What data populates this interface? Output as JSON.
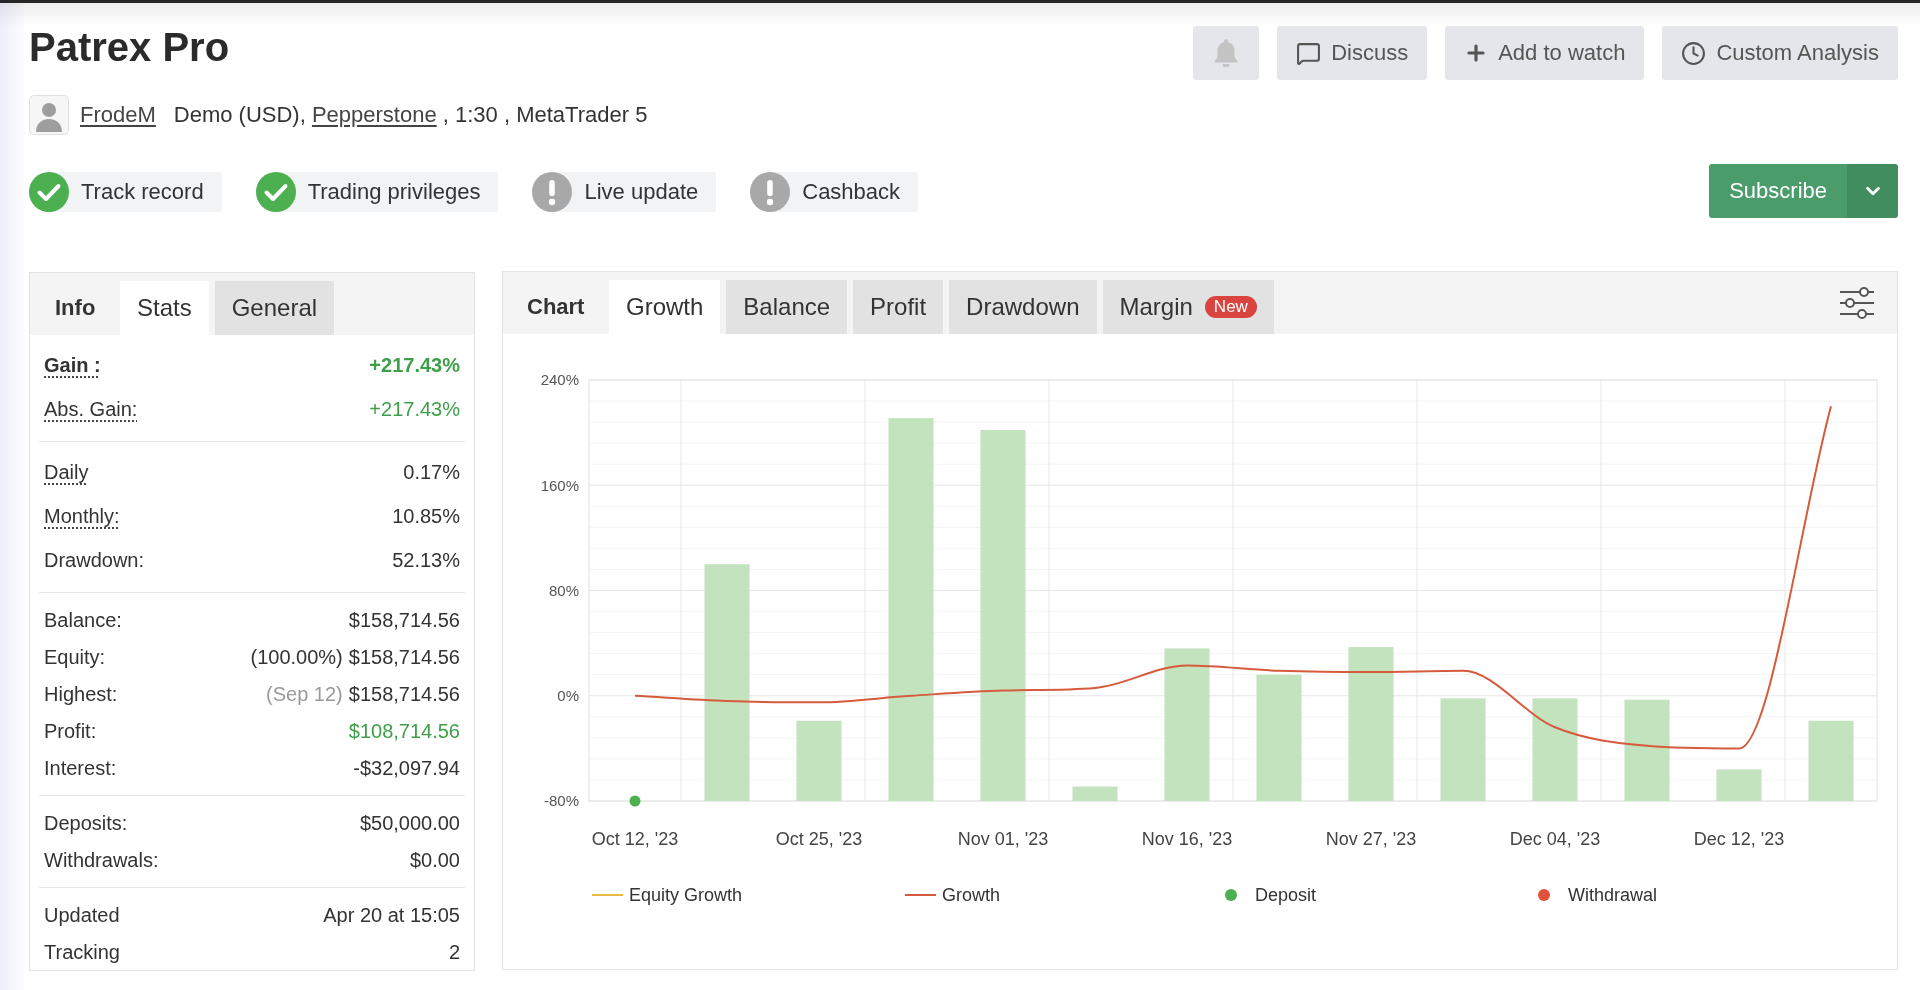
{
  "title": "Patrex Pro",
  "alert_button": {
    "disabled": true
  },
  "action_buttons": [
    {
      "label": "Discuss"
    },
    {
      "label": "Add to watch"
    },
    {
      "label": "Custom Analysis"
    }
  ],
  "account": {
    "user": "FrodeM",
    "details": [
      {
        "kind": "text",
        "text": "Demo (USD), "
      },
      {
        "kind": "link",
        "text": "Pepperstone"
      },
      {
        "kind": "text",
        "text": " , 1:30 , MetaTrader 5"
      }
    ]
  },
  "badges": [
    {
      "label": "Track record",
      "verified": true
    },
    {
      "label": "Trading privileges",
      "verified": true
    },
    {
      "label": "Live update",
      "verified": false
    },
    {
      "label": "Cashback",
      "verified": false
    }
  ],
  "subscribe_button": {
    "label": "Subscribe"
  },
  "stats_panel": {
    "heading": "Info",
    "tabs": [
      {
        "label": "Stats",
        "selected": true
      },
      {
        "label": "General",
        "selected": false
      }
    ],
    "groups": [
      [
        {
          "label": "Gain :",
          "value": "+217.43%",
          "bold": true,
          "dotted": true,
          "positive": true
        },
        {
          "label": "Abs. Gain:",
          "value": "+217.43%",
          "bold": false,
          "dotted": true,
          "positive": true
        }
      ],
      [
        {
          "label": "Daily",
          "value": "0.17%",
          "bold": false,
          "dotted": true,
          "positive": false
        },
        {
          "label": "Monthly:",
          "value": "10.85%",
          "bold": false,
          "dotted": true,
          "positive": false
        },
        {
          "label": "Drawdown:",
          "value": "52.13%",
          "bold": false,
          "dotted": false,
          "positive": false
        }
      ],
      [
        {
          "label": "Balance:",
          "value": "$158,714.56",
          "bold": false,
          "dotted": false,
          "positive": false
        },
        {
          "label": "Equity:",
          "note": "(100.00%)",
          "note_muted": false,
          "value": "$158,714.56",
          "bold": false,
          "dotted": false,
          "positive": false
        },
        {
          "label": "Highest:",
          "note": "(Sep 12)",
          "note_muted": true,
          "value": "$158,714.56",
          "bold": false,
          "dotted": false,
          "positive": false
        },
        {
          "label": "Profit:",
          "value": "$108,714.56",
          "bold": false,
          "dotted": false,
          "positive": true
        },
        {
          "label": "Interest:",
          "value": "-$32,097.94",
          "bold": false,
          "dotted": false,
          "positive": false
        }
      ],
      [
        {
          "label": "Deposits:",
          "value": "$50,000.00",
          "bold": false,
          "dotted": false,
          "positive": false
        },
        {
          "label": "Withdrawals:",
          "value": "$0.00",
          "bold": false,
          "dotted": false,
          "positive": false
        }
      ],
      [
        {
          "label": "Updated",
          "value": "Apr 20 at 15:05",
          "bold": false,
          "dotted": false,
          "positive": false
        },
        {
          "label": "Tracking",
          "value": "2",
          "bold": false,
          "dotted": false,
          "positive": false
        }
      ]
    ]
  },
  "chart_panel": {
    "heading": "Chart",
    "tabs": [
      {
        "label": "Growth",
        "selected": true
      },
      {
        "label": "Balance",
        "selected": false
      },
      {
        "label": "Profit",
        "selected": false
      },
      {
        "label": "Drawdown",
        "selected": false
      },
      {
        "label": "Margin",
        "selected": false,
        "badge": "New"
      }
    ],
    "chart_data": {
      "type": "bar",
      "categories": [
        "Oct 12, '23",
        null,
        "Oct 25, '23",
        null,
        "Nov 01, '23",
        null,
        "Nov 16, '23",
        null,
        "Nov 27, '23",
        null,
        "Dec 04, '23",
        null,
        "Dec 12, '23",
        null
      ],
      "ylim": [
        -80,
        240
      ],
      "yticks": [
        {
          "value": -80,
          "label": "-80%"
        },
        {
          "value": 0,
          "label": "0%"
        },
        {
          "value": 80,
          "label": "80%"
        },
        {
          "value": 160,
          "label": "160%"
        },
        {
          "value": 240,
          "label": "240%"
        }
      ],
      "grid": true,
      "series": [
        {
          "type": "bar",
          "color": "#c3e3bf",
          "base": [
            null,
            -80,
            -80,
            -80,
            -80,
            -80,
            -80,
            -80,
            -80,
            -80,
            -80,
            -80,
            -80,
            -80
          ],
          "values": [
            null,
            180,
            61,
            291,
            282,
            11,
            116,
            96,
            117,
            78,
            78,
            77,
            24,
            61
          ]
        },
        {
          "type": "line",
          "name": "Equity Growth",
          "color": "#e9b949",
          "values": [
            null,
            null,
            null,
            null,
            null,
            null,
            null,
            null,
            null,
            null,
            null,
            null,
            null,
            null
          ]
        },
        {
          "type": "line",
          "name": "Growth",
          "color": "#d65a3c",
          "values": [
            0,
            -4,
            -5,
            0,
            4,
            6,
            23,
            19,
            18,
            19,
            -24,
            -38,
            -40,
            220
          ]
        },
        {
          "type": "scatter",
          "name": "Deposit",
          "color": "#4caf50",
          "values": [
            -80,
            null,
            null,
            null,
            null,
            null,
            null,
            null,
            null,
            null,
            null,
            null,
            null,
            null
          ]
        },
        {
          "type": "scatter",
          "name": "Withdrawal",
          "color": "#e2513d",
          "values": [
            null,
            null,
            null,
            null,
            null,
            null,
            null,
            null,
            null,
            null,
            null,
            null,
            null,
            null
          ]
        }
      ]
    }
  }
}
